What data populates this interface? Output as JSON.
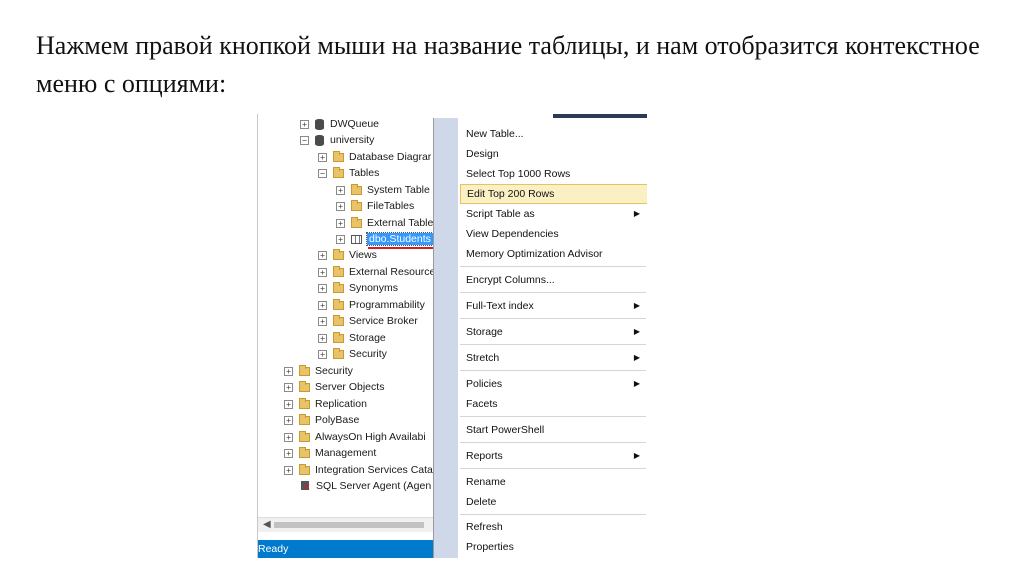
{
  "slide": {
    "text": "Нажмем правой кнопкой мыши на название таблицы, и нам отобразится контекстное меню с опциями:"
  },
  "tree": {
    "items": [
      {
        "label": "DWQueue"
      },
      {
        "label": "university"
      },
      {
        "label": "Database Diagrar"
      },
      {
        "label": "Tables"
      },
      {
        "label": "System Table"
      },
      {
        "label": "FileTables"
      },
      {
        "label": "External Table"
      },
      {
        "label": "dbo.Students"
      },
      {
        "label": "Views"
      },
      {
        "label": "External Resource"
      },
      {
        "label": "Synonyms"
      },
      {
        "label": "Programmability"
      },
      {
        "label": "Service Broker"
      },
      {
        "label": "Storage"
      },
      {
        "label": "Security"
      },
      {
        "label": "Security"
      },
      {
        "label": "Server Objects"
      },
      {
        "label": "Replication"
      },
      {
        "label": "PolyBase"
      },
      {
        "label": "AlwaysOn High Availabi"
      },
      {
        "label": "Management"
      },
      {
        "label": "Integration Services Cata"
      },
      {
        "label": "SQL Server Agent (Agen"
      }
    ],
    "expand_collapsed": "+",
    "expand_open": "−"
  },
  "status": {
    "text": "Ready",
    "color": "#007acc"
  },
  "context_menu": {
    "items": [
      {
        "label": "New Table..."
      },
      {
        "label": "Design"
      },
      {
        "label": "Select Top 1000 Rows"
      },
      {
        "label": "Edit Top 200 Rows",
        "highlighted": true
      },
      {
        "label": "Script Table as",
        "submenu": true
      },
      {
        "label": "View Dependencies"
      },
      {
        "label": "Memory Optimization Advisor"
      },
      {
        "label": "Encrypt Columns..."
      },
      {
        "label": "Full-Text index",
        "submenu": true
      },
      {
        "label": "Storage",
        "submenu": true
      },
      {
        "label": "Stretch",
        "submenu": true
      },
      {
        "label": "Policies",
        "submenu": true
      },
      {
        "label": "Facets"
      },
      {
        "label": "Start PowerShell"
      },
      {
        "label": "Reports",
        "submenu": true
      },
      {
        "label": "Rename"
      },
      {
        "label": "Delete"
      },
      {
        "label": "Refresh"
      },
      {
        "label": "Properties"
      }
    ],
    "submenu_arrow": "▶",
    "highlight_color": "#fbf0c4"
  },
  "scrollbar": {
    "left_arrow": "◀"
  }
}
